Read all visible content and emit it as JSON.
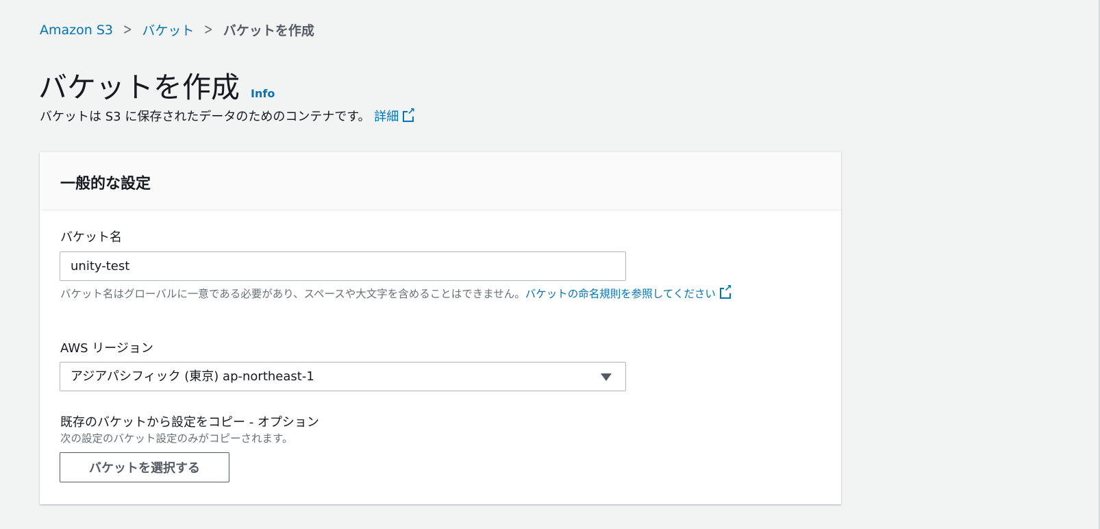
{
  "breadcrumb": {
    "items": [
      "Amazon S3",
      "バケット"
    ],
    "current": "バケットを作成"
  },
  "header": {
    "title": "バケットを作成",
    "info": "Info",
    "description": "バケットは S3 に保存されたデータのためのコンテナです。",
    "learn_more": "詳細"
  },
  "panel": {
    "title": "一般的な設定",
    "bucket_name": {
      "label": "バケット名",
      "value": "unity-test",
      "hint": "バケット名はグローバルに一意である必要があり、スペースや大文字を含めることはできません。",
      "hint_link": "バケットの命名規則を参照してください"
    },
    "region": {
      "label": "AWS リージョン",
      "value": "アジアパシフィック (東京) ap-northeast-1"
    },
    "copy": {
      "label": "既存のバケットから設定をコピー - オプション",
      "hint": "次の設定のバケット設定のみがコピーされます。",
      "button": "バケットを選択する"
    }
  }
}
